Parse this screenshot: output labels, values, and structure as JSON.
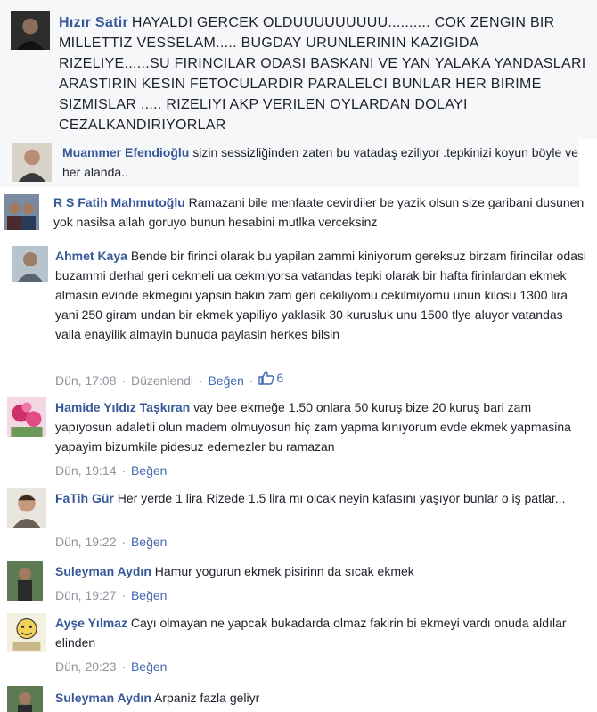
{
  "comments": [
    {
      "name": "Hızır Satir",
      "text": "HAYALDI GERCEK OLDUUUUUUUUU.......... COK ZENGIN BIR MILLETTIZ VESSELAM..... BUGDAY URUNLERININ KAZIGIDA RIZELIYE......SU FIRINCILAR ODASI BASKANI VE YAN YALAKA YANDASLARI ARASTIRIN KESIN FETOCULARDIR PARALELCI BUNLAR HER BIRIME SIZMISLAR ..... RIZELIYI AKP VERILEN OYLARDAN DOLAYI CEZALKANDIRIYORLAR",
      "avatar_icon": "profile-photo-man"
    },
    {
      "name": "Muammer Efendioğlu",
      "text": "sizin sessizliğinden zaten bu vatadaş eziliyor .tepkinizi koyun böyle ve her alanda..",
      "avatar_icon": "profile-photo-man"
    },
    {
      "name": "R S Fatih Mahmutoğlu",
      "text": "Ramazani bile menfaate cevirdiler be yazik olsun size garibani dusunen yok nasilsa allah goruyo bunun hesabini mutlka verceksinz",
      "avatar_icon": "profile-photo-people"
    },
    {
      "name": "Ahmet Kaya",
      "text": "Bende bir firinci olarak bu yapilan zammi kiniyorum gereksuz birzam firincilar odasi buzammi derhal geri cekmeli ua cekmiyorsa vatandas tepki olarak bir hafta firinlardan ekmek almasin evinde ekmegini yapsin bakin zam geri cekiliyomu cekilmiyomu unun kilosu 1300 lira yani 250 giram undan bir ekmek yapiliyo yaklasik 30 kurusluk unu 1500 tlye aluyor vatandas valla enayilik almayin bunuda paylasin herkes bilsin",
      "avatar_icon": "profile-photo-man",
      "time": "Dün, 17:08",
      "edited": "Düzenlendi",
      "like_label": "Beğen",
      "like_count": "6"
    },
    {
      "name": "Hamide Yıldız Taşkıran",
      "text": "vay bee ekmeğe 1.50 onlara 50 kuruş bize 20 kuruş bari zam yapıyosun adaletli olun madem olmuyosun hiç zam yapma kınıyorum evde ekmek yapmasina yapayim bizumkile pidesuz edemezler bu ramazan",
      "avatar_icon": "profile-photo-flowers",
      "time": "Dün, 19:14",
      "like_label": "Beğen"
    },
    {
      "name": "FaTih Gür",
      "text": "Her yerde 1 lira Rizede 1.5 lira mı olcak neyin kafasını yaşıyor bunlar o iş patlar...",
      "avatar_icon": "profile-photo-man",
      "time": "Dün, 19:22",
      "like_label": "Beğen"
    },
    {
      "name": "Suleyman Aydın",
      "text": "Hamur yogurun ekmek pisirinn da sıcak ekmek",
      "avatar_icon": "profile-photo-man",
      "time": "Dün, 19:27",
      "like_label": "Beğen"
    },
    {
      "name": "Ayşe Yılmaz",
      "text": "Cayı olmayan ne yapcak bukadarda olmaz fakirin bi ekmeyi vardı onuda aldılar elinden",
      "avatar_icon": "profile-photo-cartoon",
      "time": "Dün, 20:23",
      "like_label": "Beğen"
    },
    {
      "name": "Suleyman Aydın",
      "text": "Arpaniz fazla geliyr",
      "avatar_icon": "profile-photo-man"
    }
  ],
  "colors": {
    "name": "#365899",
    "text": "#1d2129",
    "meta": "#90949c",
    "link": "#4267b2",
    "panel": "#f6f7f9"
  }
}
